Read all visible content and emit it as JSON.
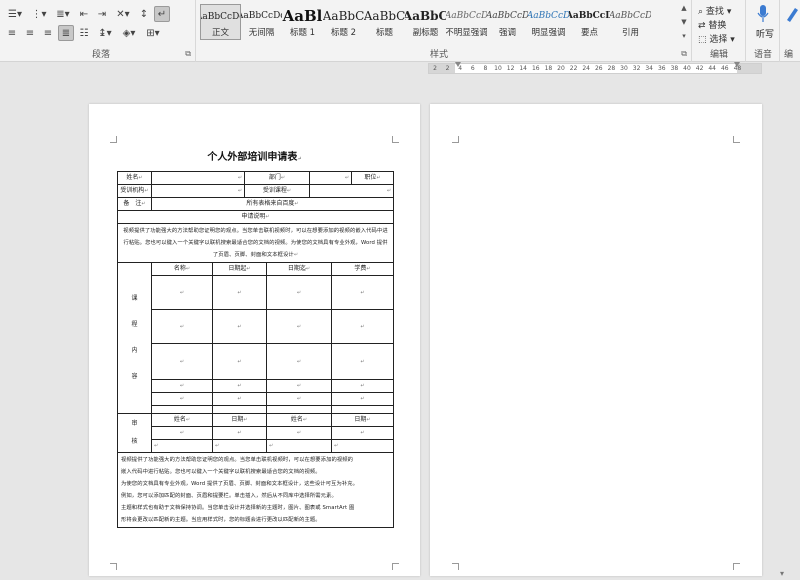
{
  "ribbon": {
    "paragraph_label": "段落",
    "styles_label": "样式",
    "edit_label": "编辑",
    "voice_label": "语音",
    "editor_label": "编",
    "styles": [
      {
        "preview": "AaBbCcDd",
        "name": "正文",
        "size": 9,
        "bold": false,
        "italic": false,
        "color": "#222222",
        "selected": true
      },
      {
        "preview": "AaBbCcDd",
        "name": "无间隔",
        "size": 9,
        "bold": false,
        "italic": false,
        "color": "#222222",
        "selected": false
      },
      {
        "preview": "AaBl",
        "name": "标题 1",
        "size": 15,
        "bold": true,
        "italic": false,
        "color": "#111111",
        "selected": false
      },
      {
        "preview": "AaBbC",
        "name": "标题 2",
        "size": 12,
        "bold": false,
        "italic": false,
        "color": "#222222",
        "selected": false
      },
      {
        "preview": "AaBbC",
        "name": "标题",
        "size": 12,
        "bold": false,
        "italic": false,
        "color": "#222222",
        "selected": false
      },
      {
        "preview": "AaBbC",
        "name": "副标题",
        "size": 12,
        "bold": true,
        "italic": false,
        "color": "#222222",
        "selected": false
      },
      {
        "preview": "AaBbCcD",
        "name": "不明显强调",
        "size": 9,
        "bold": false,
        "italic": true,
        "color": "#666666",
        "selected": false
      },
      {
        "preview": "AaBbCcD",
        "name": "强调",
        "size": 9,
        "bold": false,
        "italic": true,
        "color": "#444444",
        "selected": false
      },
      {
        "preview": "AaBbCcD",
        "name": "明显强调",
        "size": 9,
        "bold": false,
        "italic": true,
        "color": "#2e74b5",
        "selected": false
      },
      {
        "preview": "AaBbCcD",
        "name": "要点",
        "size": 9,
        "bold": true,
        "italic": false,
        "color": "#222222",
        "selected": false
      },
      {
        "preview": "AaBbCcD",
        "name": "引用",
        "size": 9,
        "bold": false,
        "italic": true,
        "color": "#555555",
        "selected": false
      }
    ],
    "edit_items": [
      {
        "icon": "search-icon",
        "label": "查找"
      },
      {
        "icon": "replace-icon",
        "label": "替换"
      },
      {
        "icon": "select-icon",
        "label": "选择"
      }
    ],
    "voice": {
      "icon": "microphone-icon",
      "label": "听写"
    }
  },
  "ruler": {
    "ticks": [
      "2",
      "2",
      "4",
      "6",
      "8",
      "10",
      "12",
      "14",
      "16",
      "18",
      "20",
      "22",
      "24",
      "26",
      "28",
      "30",
      "32",
      "34",
      "36",
      "38",
      "40",
      "42",
      "44",
      "46",
      "48"
    ]
  },
  "form": {
    "title": "个人外部培训申请表",
    "name_label": "姓名",
    "dept_label": "部门",
    "position_label": "职位",
    "org_label": "受训机构",
    "course_label": "受训课程",
    "remark_label": "备　注",
    "remark_value": "所有表格来自百度",
    "desc_label": "申请说明",
    "desc_text": "视频提供了功能强大的方法帮助您证明您的观点。当您单击联机视频时，可以在想要添加的视频的嵌入代码中进行粘贴。您也可以键入一个关键字以联机搜索最适合您的文档的视频。为使您的文档具有专业外观，Word 提供了页眉、页脚、封面和文本框设计",
    "course_content_label": [
      "课",
      "程",
      "内",
      "容"
    ],
    "course_headers": [
      "名称",
      "日期起",
      "日期迄",
      "学费"
    ],
    "approve_label": [
      "审",
      "核"
    ],
    "approve_headers": [
      "姓名",
      "日期",
      "姓名",
      "日期"
    ],
    "footer_lines": [
      "视频提供了功能强大的方法帮助您证明您的观点。当您单击联机视频时，可以在想要添加的视频的",
      "嵌入代码中进行粘贴。您也可以键入一个关键字以联机搜索最适合您的文档的视频。",
      "为使您的文档具有专业外观，Word 提供了页眉、页脚、封面和文本框设计，这些设计可互为补充。",
      "例如，您可以添加匹配的封面、页眉和提要栏。单击插入，然后从不同库中选择所需元素。",
      "主题和样式也有助于文档保持协调。当您单击设计并选择新的主题时，图片、图表或 SmartArt 图",
      "形将会更改以匹配新的主题。当应用样式时，您的标题会进行更改以匹配新的主题。"
    ]
  }
}
